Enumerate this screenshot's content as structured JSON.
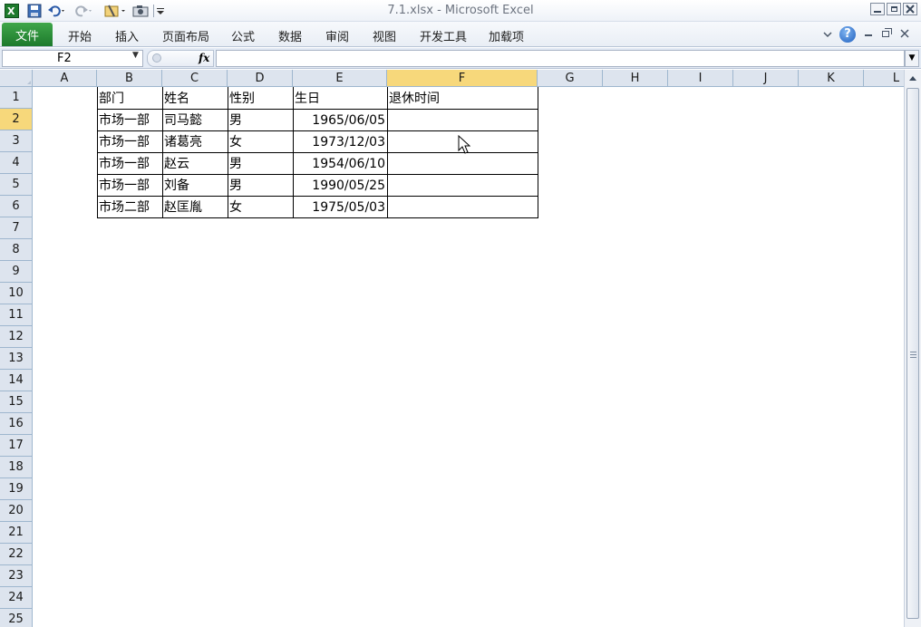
{
  "window": {
    "title": "7.1.xlsx  -  Microsoft Excel"
  },
  "ribbon": {
    "file_tab": "文件",
    "tabs": [
      "开始",
      "插入",
      "页面布局",
      "公式",
      "数据",
      "审阅",
      "视图",
      "开发工具",
      "加载项"
    ]
  },
  "formula_bar": {
    "name_box": "F2",
    "fx": "fx",
    "formula": ""
  },
  "columns": [
    "A",
    "B",
    "C",
    "D",
    "E",
    "F",
    "G",
    "H",
    "I",
    "J",
    "K",
    "L"
  ],
  "rows": [
    "1",
    "2",
    "3",
    "4",
    "5",
    "6",
    "7",
    "8",
    "9",
    "10",
    "11",
    "12",
    "13",
    "14",
    "15",
    "16",
    "17",
    "18",
    "19",
    "20",
    "21",
    "22",
    "23",
    "24",
    "25"
  ],
  "table": {
    "headers": [
      "部门",
      "姓名",
      "性别",
      "生日",
      "退休时间"
    ],
    "rows": [
      [
        "市场一部",
        "司马懿",
        "男",
        "1965/06/05",
        ""
      ],
      [
        "市场一部",
        "诸葛亮",
        "女",
        "1973/12/03",
        ""
      ],
      [
        "市场一部",
        "赵云",
        "男",
        "1954/06/10",
        ""
      ],
      [
        "市场一部",
        "刘备",
        "男",
        "1990/05/25",
        ""
      ],
      [
        "市场二部",
        "赵匡胤",
        "女",
        "1975/05/03",
        ""
      ]
    ]
  },
  "colors": {
    "file_tab": "#1d7a2c",
    "header_bg": "#dde4ee",
    "selected_header": "#f7d87b"
  },
  "icons": [
    "excel-app-icon",
    "save-icon",
    "undo-icon",
    "redo-icon",
    "customize-icon",
    "camera-icon",
    "help-icon",
    "minimize-icon",
    "restore-icon",
    "close-icon"
  ]
}
